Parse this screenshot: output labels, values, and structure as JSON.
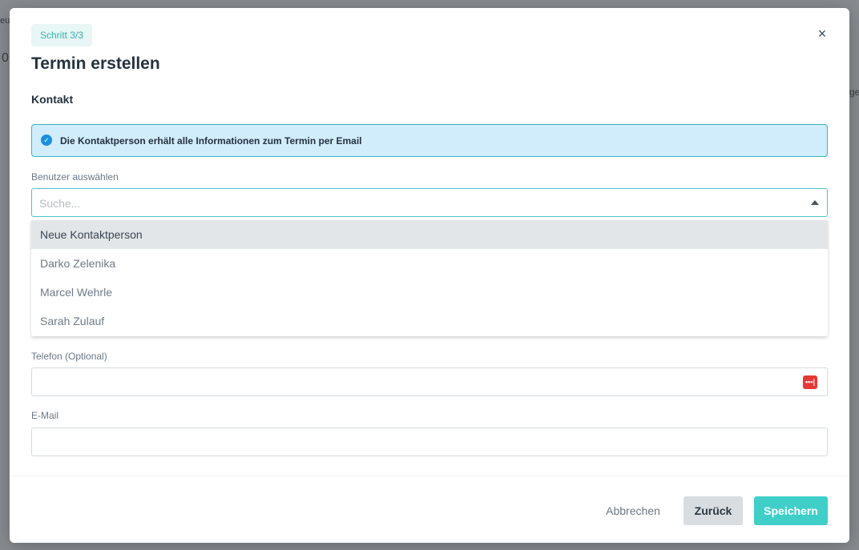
{
  "background": {
    "fragments": [
      "eu",
      "0",
      "ge"
    ]
  },
  "modal": {
    "step": "Schritt 3/3",
    "title": "Termin erstellen",
    "section": "Kontakt",
    "info": {
      "icon": "check-circle-icon",
      "text": "Die Kontaktperson erhält alle Informationen zum Termin per Email"
    },
    "user_select": {
      "label": "Benutzer auswählen",
      "placeholder": "Suche...",
      "options": [
        "Neue Kontaktperson",
        "Darko Zelenika",
        "Marcel Wehrle",
        "Sarah Zulauf"
      ],
      "highlighted": "Neue Kontaktperson"
    },
    "phone": {
      "label": "Telefon (Optional)",
      "value": "",
      "badge_icon": "password-manager-icon",
      "badge_text": "•••|"
    },
    "email": {
      "label": "E-Mail",
      "value": ""
    },
    "footer": {
      "cancel": "Abbrechen",
      "back": "Zurück",
      "save": "Speichern"
    },
    "close_icon": "×"
  },
  "colors": {
    "accent": "#3fcfc8",
    "info_bg": "#d1ecfb",
    "info_border": "#35b6c0",
    "badge_red": "#e53935"
  }
}
